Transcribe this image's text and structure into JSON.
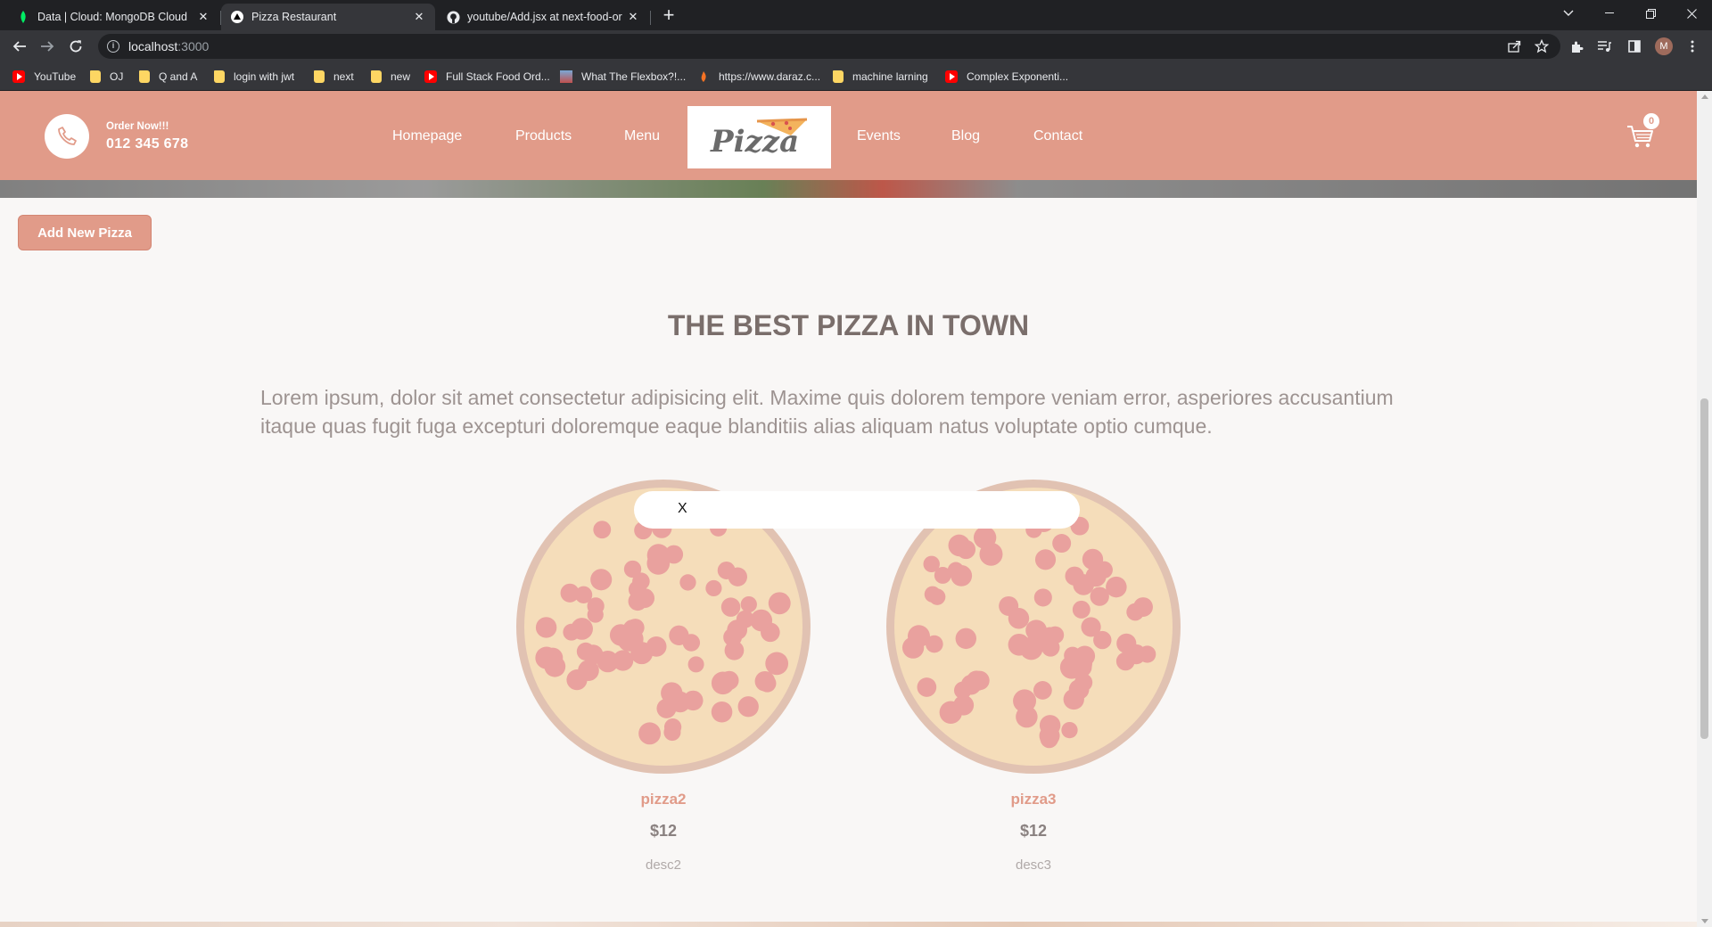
{
  "browser": {
    "tabs": [
      {
        "title": "Data | Cloud: MongoDB Cloud",
        "icon": "mongodb-leaf-icon",
        "active": false
      },
      {
        "title": "Pizza Restaurant",
        "icon": "triangle-icon",
        "active": true
      },
      {
        "title": "youtube/Add.jsx at next-food-or",
        "icon": "github-icon",
        "active": false
      }
    ],
    "tab_close": "✕",
    "new_tab": "+",
    "url_host": "localhost",
    "url_port": ":3000",
    "profile_initial": "M",
    "bookmarks": [
      {
        "label": "YouTube",
        "icon": "youtube-icon"
      },
      {
        "label": "OJ",
        "icon": "folder-icon"
      },
      {
        "label": "Q and A",
        "icon": "folder-icon"
      },
      {
        "label": "login with jwt",
        "icon": "folder-icon"
      },
      {
        "label": "next",
        "icon": "folder-icon"
      },
      {
        "label": "new",
        "icon": "folder-icon"
      },
      {
        "label": "Full Stack Food Ord...",
        "icon": "youtube-icon"
      },
      {
        "label": "What The Flexbox?!...",
        "icon": "site-icon"
      },
      {
        "label": "https://www.daraz.c...",
        "icon": "daraz-icon"
      },
      {
        "label": "machine larning",
        "icon": "folder-icon"
      },
      {
        "label": "Complex Exponenti...",
        "icon": "youtube-icon"
      }
    ]
  },
  "site": {
    "nav": {
      "order_label": "Order Now!!!",
      "phone": "012 345 678",
      "links": [
        "Homepage",
        "Products",
        "Menu",
        "Events",
        "Blog",
        "Contact"
      ],
      "logo_text": "Pizza",
      "cart_count": "0"
    },
    "add_button": "Add New Pizza",
    "section": {
      "title": "THE BEST PIZZA IN TOWN",
      "description": "Lorem ipsum, dolor sit amet consectetur adipisicing elit. Maxime quis dolorem tempore veniam error, asperiores accusantium itaque quas fugit fuga excepturi doloremque eaque blanditiis alias aliquam natus voluptate optio cumque."
    },
    "pizzas": [
      {
        "name": "pizza2",
        "price": "$12",
        "desc": "desc2"
      },
      {
        "name": "pizza3",
        "price": "$12",
        "desc": "desc3"
      }
    ],
    "modal": {
      "close_label": "X"
    }
  },
  "colors": {
    "brand": "#e19b89",
    "background": "#f9f7f6",
    "title": "#7a6e6b"
  }
}
